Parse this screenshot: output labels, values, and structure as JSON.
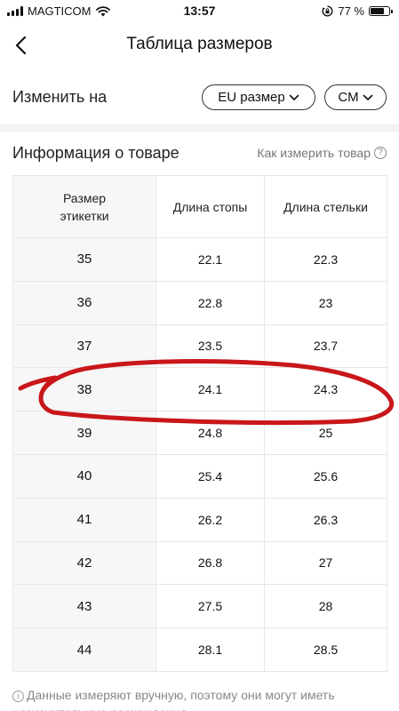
{
  "status_bar": {
    "carrier": "MAGTICOM",
    "time": "13:57",
    "battery_percent": "77 %",
    "battery_level": 0.77
  },
  "nav": {
    "title": "Таблица размеров"
  },
  "units": {
    "label": "Изменить на",
    "size_system": "EU размер",
    "measure_unit": "СМ"
  },
  "section": {
    "title": "Информация о товаре",
    "how_to_measure": "Как измерить товар"
  },
  "table": {
    "headers": {
      "label_size_line1": "Размер",
      "label_size_line2": "этикетки",
      "foot_length": "Длина стопы",
      "insole_length": "Длина стельки"
    },
    "rows": [
      {
        "size": "35",
        "foot": "22.1",
        "insole": "22.3"
      },
      {
        "size": "36",
        "foot": "22.8",
        "insole": "23"
      },
      {
        "size": "37",
        "foot": "23.5",
        "insole": "23.7"
      },
      {
        "size": "38",
        "foot": "24.1",
        "insole": "24.3"
      },
      {
        "size": "39",
        "foot": "24.8",
        "insole": "25"
      },
      {
        "size": "40",
        "foot": "25.4",
        "insole": "25.6"
      },
      {
        "size": "41",
        "foot": "26.2",
        "insole": "26.3"
      },
      {
        "size": "42",
        "foot": "26.8",
        "insole": "27"
      },
      {
        "size": "43",
        "foot": "27.5",
        "insole": "28"
      },
      {
        "size": "44",
        "foot": "28.1",
        "insole": "28.5"
      }
    ]
  },
  "footnote": {
    "text": "Данные измеряют вручную, поэтому они могут иметь незначительные расхождения"
  },
  "colors": {
    "annotation": "#c8171b",
    "label_column_bg": "#f7f7f7",
    "divider": "#f2f2f2"
  }
}
